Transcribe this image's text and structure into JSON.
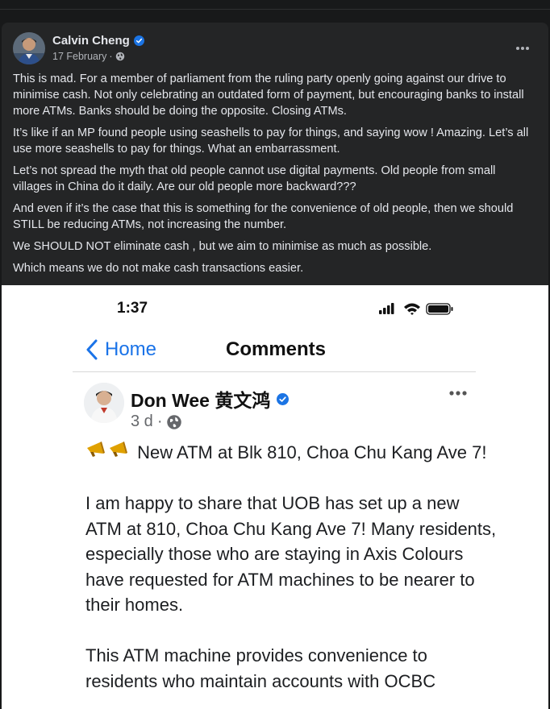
{
  "post": {
    "author": "Calvin Cheng",
    "date": "17 February",
    "meta_separator": "·",
    "paragraphs": [
      "This is mad. For a member of parliament from the ruling party openly going against our drive to minimise cash. Not only celebrating an outdated form of payment, but encouraging banks to install more ATMs. Banks should be doing the opposite. Closing ATMs.",
      "It’s like if an MP found people using seashells to pay for things, and saying wow ! Amazing. Let’s all use more seashells  to pay for things.  What an embarrassment.",
      "Let’s not spread the myth that old people cannot use digital payments. Old people from small villages in China do it daily. Are our old people more backward???",
      "And even if it’s the case that this is something for the convenience of old people, then we should STILL be reducing ATMs, not increasing the number.",
      "We SHOULD NOT eliminate cash , but we aim to minimise as much as possible.",
      "Which means we do not make cash transactions easier."
    ]
  },
  "screenshot": {
    "status_time": "1:37",
    "back_label": "Home",
    "nav_title": "Comments",
    "author": "Don Wee 黄文鸿",
    "age": "3 d",
    "meta_separator": "·",
    "headline": "New ATM at Blk 810, Choa Chu Kang Ave 7!",
    "paragraphs": [
      "I am happy to share that UOB has set up a new ATM at 810, Choa Chu Kang Ave 7! Many residents, especially those who are staying in Axis Colours have requested for ATM machines to be nearer to their homes.",
      "This ATM machine provides convenience to residents who maintain accounts with OCBC"
    ]
  },
  "colors": {
    "page_bg": "#18191a",
    "card_bg": "#242526",
    "primary_text": "#e4e6eb",
    "secondary_text": "#b0b3b8",
    "verified_blue": "#1b74e4",
    "ios_blue": "#1a73e8"
  },
  "icons": [
    "verified-badge-icon",
    "globe-icon",
    "more-options-icon",
    "cellular-signal-icon",
    "wifi-icon",
    "battery-icon",
    "back-chevron-icon",
    "megaphone-icon"
  ]
}
